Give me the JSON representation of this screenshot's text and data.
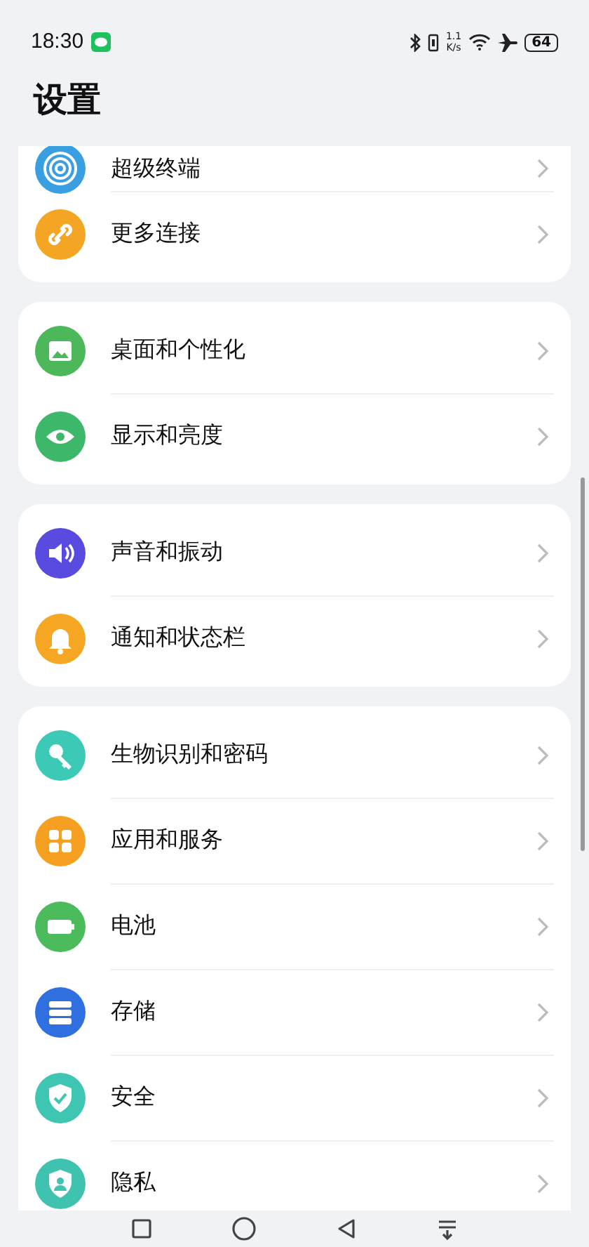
{
  "status_bar": {
    "time": "18:30",
    "speed_value": "1.1",
    "speed_unit": "K/s",
    "battery": "64"
  },
  "title": "设置",
  "groups": [
    {
      "items": [
        {
          "label": "超级终端",
          "color": "#3a9fe0"
        },
        {
          "label": "更多连接",
          "color": "#f5a524"
        }
      ]
    },
    {
      "items": [
        {
          "label": "桌面和个性化",
          "color": "#4cb85a"
        },
        {
          "label": "显示和亮度",
          "color": "#3db86b"
        }
      ]
    },
    {
      "items": [
        {
          "label": "声音和振动",
          "color": "#5a4be0"
        },
        {
          "label": "通知和状态栏",
          "color": "#f5a623"
        }
      ]
    },
    {
      "items": [
        {
          "label": "生物识别和密码",
          "color": "#3ccab6"
        },
        {
          "label": "应用和服务",
          "color": "#f5a020"
        },
        {
          "label": "电池",
          "color": "#4cbb5c"
        },
        {
          "label": "存储",
          "color": "#2f6fe0"
        },
        {
          "label": "安全",
          "color": "#3fc6b2"
        },
        {
          "label": "隐私",
          "color": "#40c2b0"
        }
      ]
    }
  ]
}
